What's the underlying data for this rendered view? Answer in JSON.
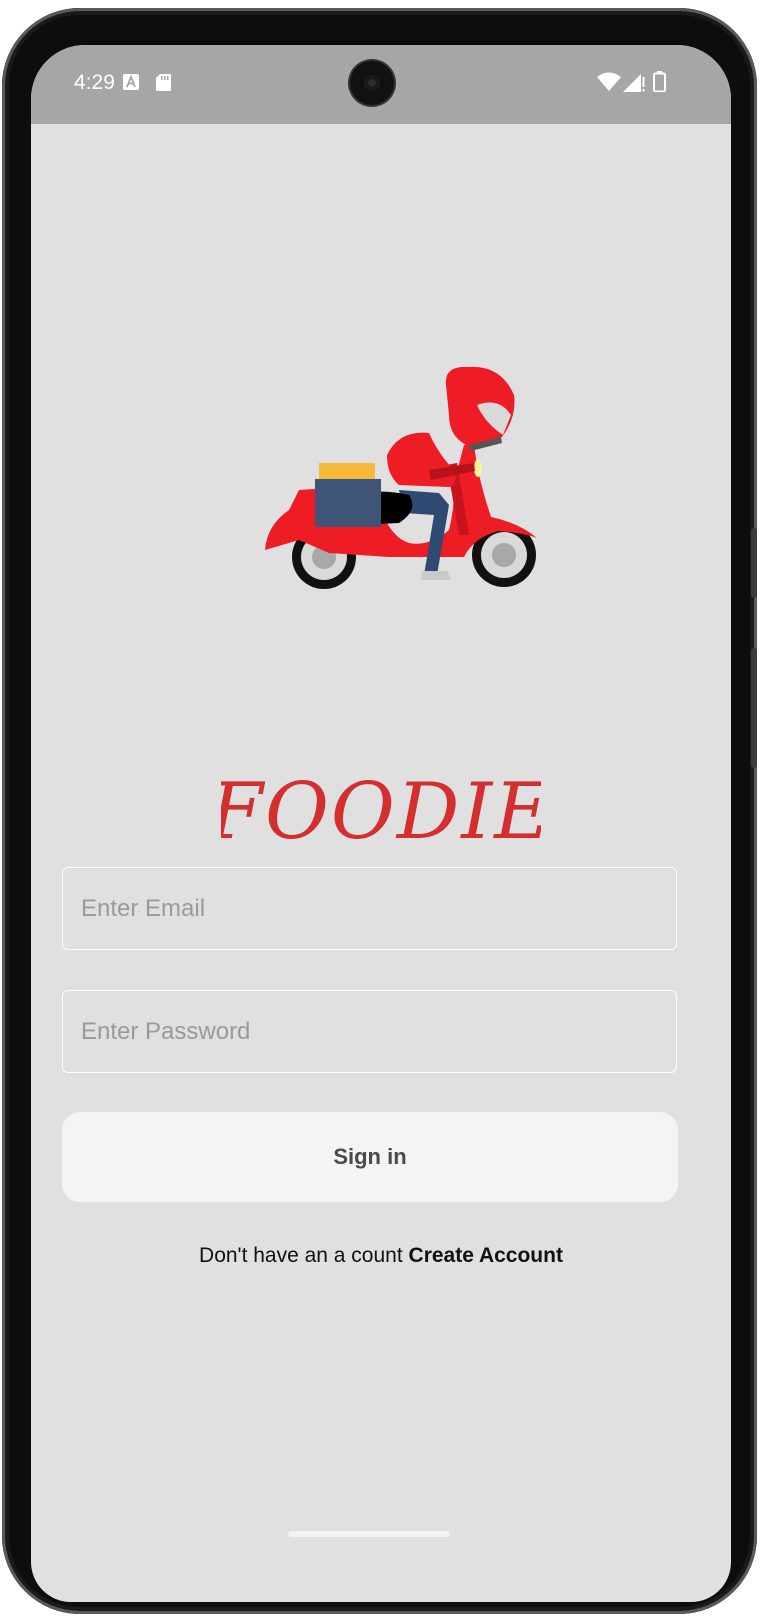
{
  "status_bar": {
    "time": "4:29",
    "icons": [
      "text-a-notification-icon",
      "sd-card-icon",
      "wifi-icon",
      "signal-icon",
      "battery-icon"
    ]
  },
  "brand": {
    "logo_text": "FOODIE",
    "color": "#d32f2f"
  },
  "illustration": {
    "name": "delivery-scooter-icon"
  },
  "login": {
    "email_placeholder": "Enter Email",
    "password_placeholder": "Enter Password",
    "signin_label": "Sign in",
    "signup_prompt": "Don't have an a count",
    "signup_link": "Create Account"
  },
  "colors": {
    "screen_background": "#e0e0e0",
    "status_bar": "#a6a6a6",
    "accent_red": "#ee1c25",
    "button_background": "#f4f4f4"
  }
}
